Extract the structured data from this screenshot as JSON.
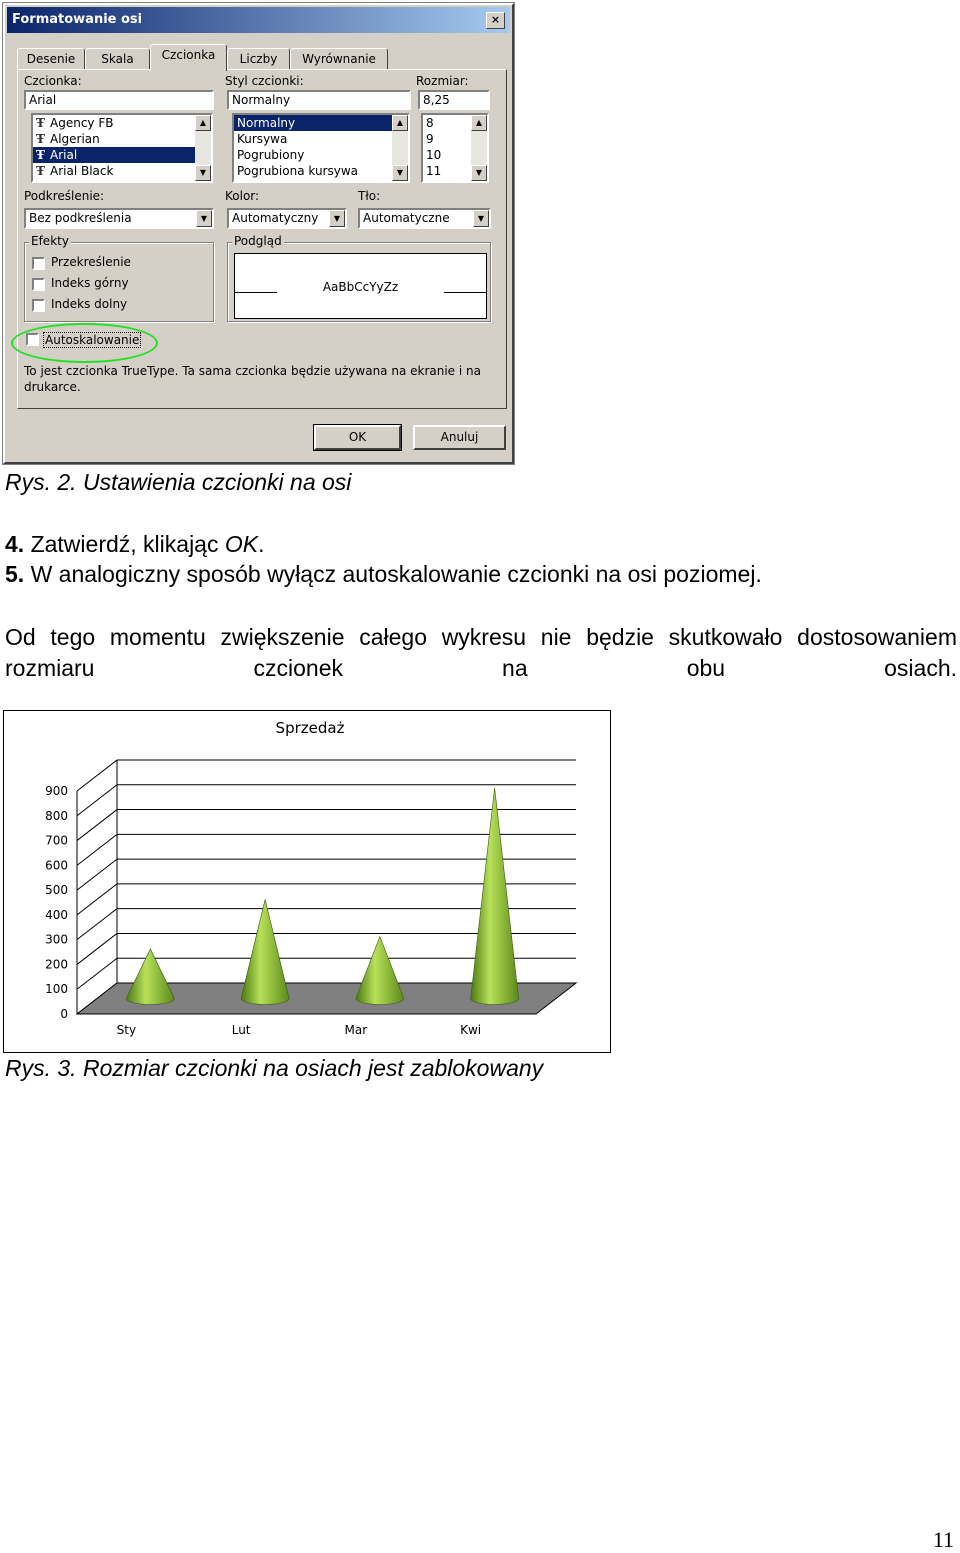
{
  "dialog": {
    "title": "Formatowanie osi",
    "close_glyph": "×",
    "tabs": [
      "Desenie",
      "Skala",
      "Czcionka",
      "Liczby",
      "Wyrównanie"
    ],
    "active_tab": "Czcionka",
    "font": {
      "label": "Czcionka:",
      "value": "Arial",
      "items": [
        "Agency FB",
        "Algerian",
        "Arial",
        "Arial Black"
      ],
      "selected": "Arial",
      "icon_glyph": "Ŧ"
    },
    "style": {
      "label": "Styl czcionki:",
      "value": "Normalny",
      "items": [
        "Normalny",
        "Kursywa",
        "Pogrubiony",
        "Pogrubiona kursywa"
      ],
      "selected": "Normalny"
    },
    "size": {
      "label": "Rozmiar:",
      "value": "8,25",
      "items": [
        "8",
        "9",
        "10",
        "11"
      ]
    },
    "underline": {
      "label": "Podkreślenie:",
      "value": "Bez podkreślenia"
    },
    "color": {
      "label": "Kolor:",
      "value": "Automatyczny"
    },
    "background": {
      "label": "Tło:",
      "value": "Automatyczne"
    },
    "effects": {
      "label": "Efekty",
      "items": [
        {
          "label": "Przekreślenie",
          "checked": false
        },
        {
          "label": "Indeks górny",
          "checked": false
        },
        {
          "label": "Indeks dolny",
          "checked": false
        }
      ]
    },
    "preview": {
      "label": "Podgląd",
      "sample": "AaBbCcYyZz"
    },
    "autoscale": {
      "label": "Autoskalowanie",
      "checked": false
    },
    "info_text": "To jest czcionka TrueType. Ta sama czcionka będzie używana na ekranie i na drukarce.",
    "ok_label": "OK",
    "cancel_label": "Anuluj",
    "highlight_color": "#22e022"
  },
  "caption1": "Rys. 2. Ustawienia czcionki na osi",
  "steps": [
    {
      "num": "4.",
      "text_before": "Zatwierdź, klikając ",
      "text_italic": "OK",
      "text_after": "."
    },
    {
      "num": "5.",
      "text_before": "W analogiczny sposób wyłącz autoskalowanie czcionki na osi poziomej.",
      "text_italic": "",
      "text_after": ""
    }
  ],
  "paragraph": "Od tego momentu zwiększenie całego wykresu nie będzie skutkowało dostosowaniem rozmiaru czcionek na obu osiach.",
  "chart_data": {
    "type": "bar",
    "style": "3d-cone",
    "title": "Sprzedaż",
    "categories": [
      "Sty",
      "Lut",
      "Mar",
      "Kwi"
    ],
    "values": [
      200,
      400,
      250,
      850
    ],
    "ylim": [
      0,
      900
    ],
    "yticks": [
      0,
      100,
      200,
      300,
      400,
      500,
      600,
      700,
      800,
      900
    ],
    "grid": true,
    "legend": "none",
    "bar_color": "#8cc63f",
    "floor_color": "#808080"
  },
  "caption2": "Rys. 3. Rozmiar czcionki na osiach jest zablokowany",
  "page_number": "11"
}
